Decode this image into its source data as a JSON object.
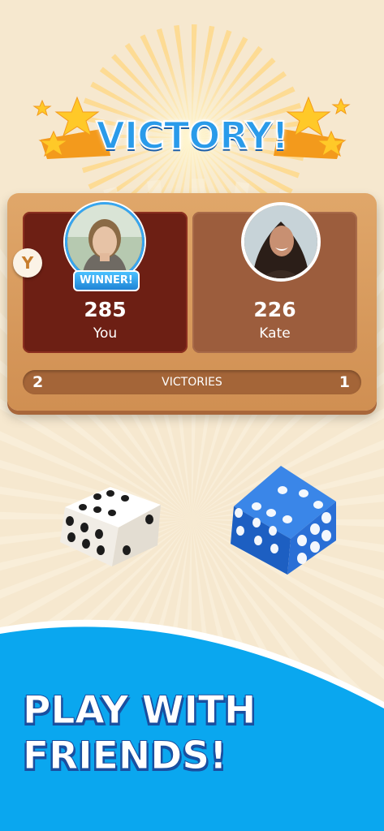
{
  "header": {
    "title": "VICTORY!"
  },
  "board": {
    "players": [
      {
        "name": "You",
        "score": "285",
        "badge": "WINNER!"
      },
      {
        "name": "Kate",
        "score": "226"
      }
    ],
    "victories": {
      "label": "VICTORIES",
      "you": "2",
      "kate": "1"
    },
    "token_letter": "Y"
  },
  "dice": {
    "white_face": 6,
    "blue_face": 6
  },
  "tagline": {
    "line1": "PLAY WITH",
    "line2": "FRIENDS!"
  },
  "colors": {
    "accent_blue": "#2a9bea",
    "panel_blue": "#0aa7ef",
    "board_wood": "#d9995d",
    "winner_card": "#6d1f14",
    "loser_card": "#9c5d3d"
  }
}
